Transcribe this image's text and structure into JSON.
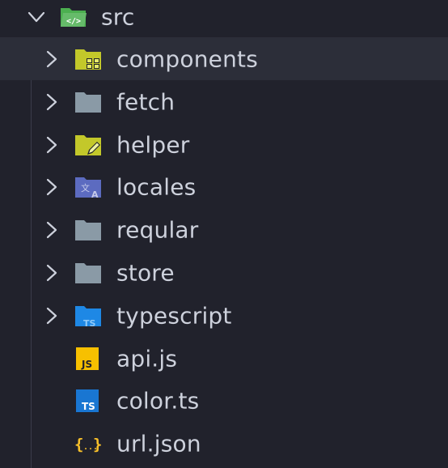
{
  "explorer": {
    "root": {
      "label": "src",
      "icon": "folder-src-open-icon",
      "expanded": true
    },
    "items": [
      {
        "label": "components",
        "type": "folder",
        "icon": "folder-components-icon",
        "color": "#c3c82a"
      },
      {
        "label": "fetch",
        "type": "folder",
        "icon": "folder-icon",
        "color": "#8a9aa6"
      },
      {
        "label": "helper",
        "type": "folder",
        "icon": "folder-helper-icon",
        "color": "#c3c82a"
      },
      {
        "label": "locales",
        "type": "folder",
        "icon": "folder-locales-icon",
        "color": "#5c6bc0"
      },
      {
        "label": "reqular",
        "type": "folder",
        "icon": "folder-icon",
        "color": "#8a9aa6"
      },
      {
        "label": "store",
        "type": "folder",
        "icon": "folder-icon",
        "color": "#8a9aa6"
      },
      {
        "label": "typescript",
        "type": "folder",
        "icon": "folder-typescript-icon",
        "color": "#1e88e5"
      },
      {
        "label": "api.js",
        "type": "file",
        "icon": "javascript-file-icon",
        "color": "#f7c000"
      },
      {
        "label": "color.ts",
        "type": "file",
        "icon": "typescript-file-icon",
        "color": "#1976d2"
      },
      {
        "label": "url.json",
        "type": "file",
        "icon": "json-file-icon",
        "color": "#f9c12a"
      }
    ]
  }
}
